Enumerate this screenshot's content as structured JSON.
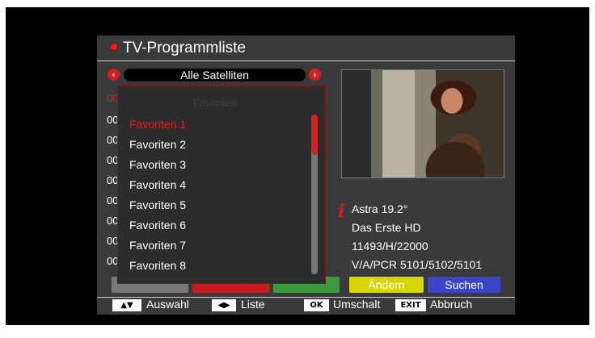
{
  "window": {
    "title": "TV-Programmliste"
  },
  "satellite": {
    "label": "Alle Satelliten"
  },
  "channel_rows": [
    "00",
    "00",
    "00",
    "00",
    "00",
    "00",
    "00",
    "00",
    "00"
  ],
  "popup": {
    "title": "Favoriten",
    "selected_index": 0,
    "items": [
      "Favoriten 1",
      "Favoriten 2",
      "Favoriten 3",
      "Favoriten 4",
      "Favoriten 5",
      "Favoriten 6",
      "Favoriten 7",
      "Favoriten 8"
    ]
  },
  "info": {
    "satellite": "Astra 19.2°",
    "channel": "Das Erste HD",
    "transponder": "11493/H/22000",
    "pids": "V/A/PCR 5101/5102/5101"
  },
  "color_buttons": {
    "yellow_label": "Ändern",
    "blue_label": "Suchen"
  },
  "hints": [
    {
      "key": "▲▼",
      "label": "Auswahl"
    },
    {
      "key": "◀▶",
      "label": "Liste"
    },
    {
      "key": "OK",
      "label": "Umschalt"
    },
    {
      "key": "EXIT",
      "label": "Abbruch"
    }
  ],
  "colors": {
    "accent_red": "#d42020",
    "yellow": "#d6d600",
    "blue": "#3a45c8",
    "green": "#3c9a3c",
    "panel": "#3a3a3c"
  }
}
